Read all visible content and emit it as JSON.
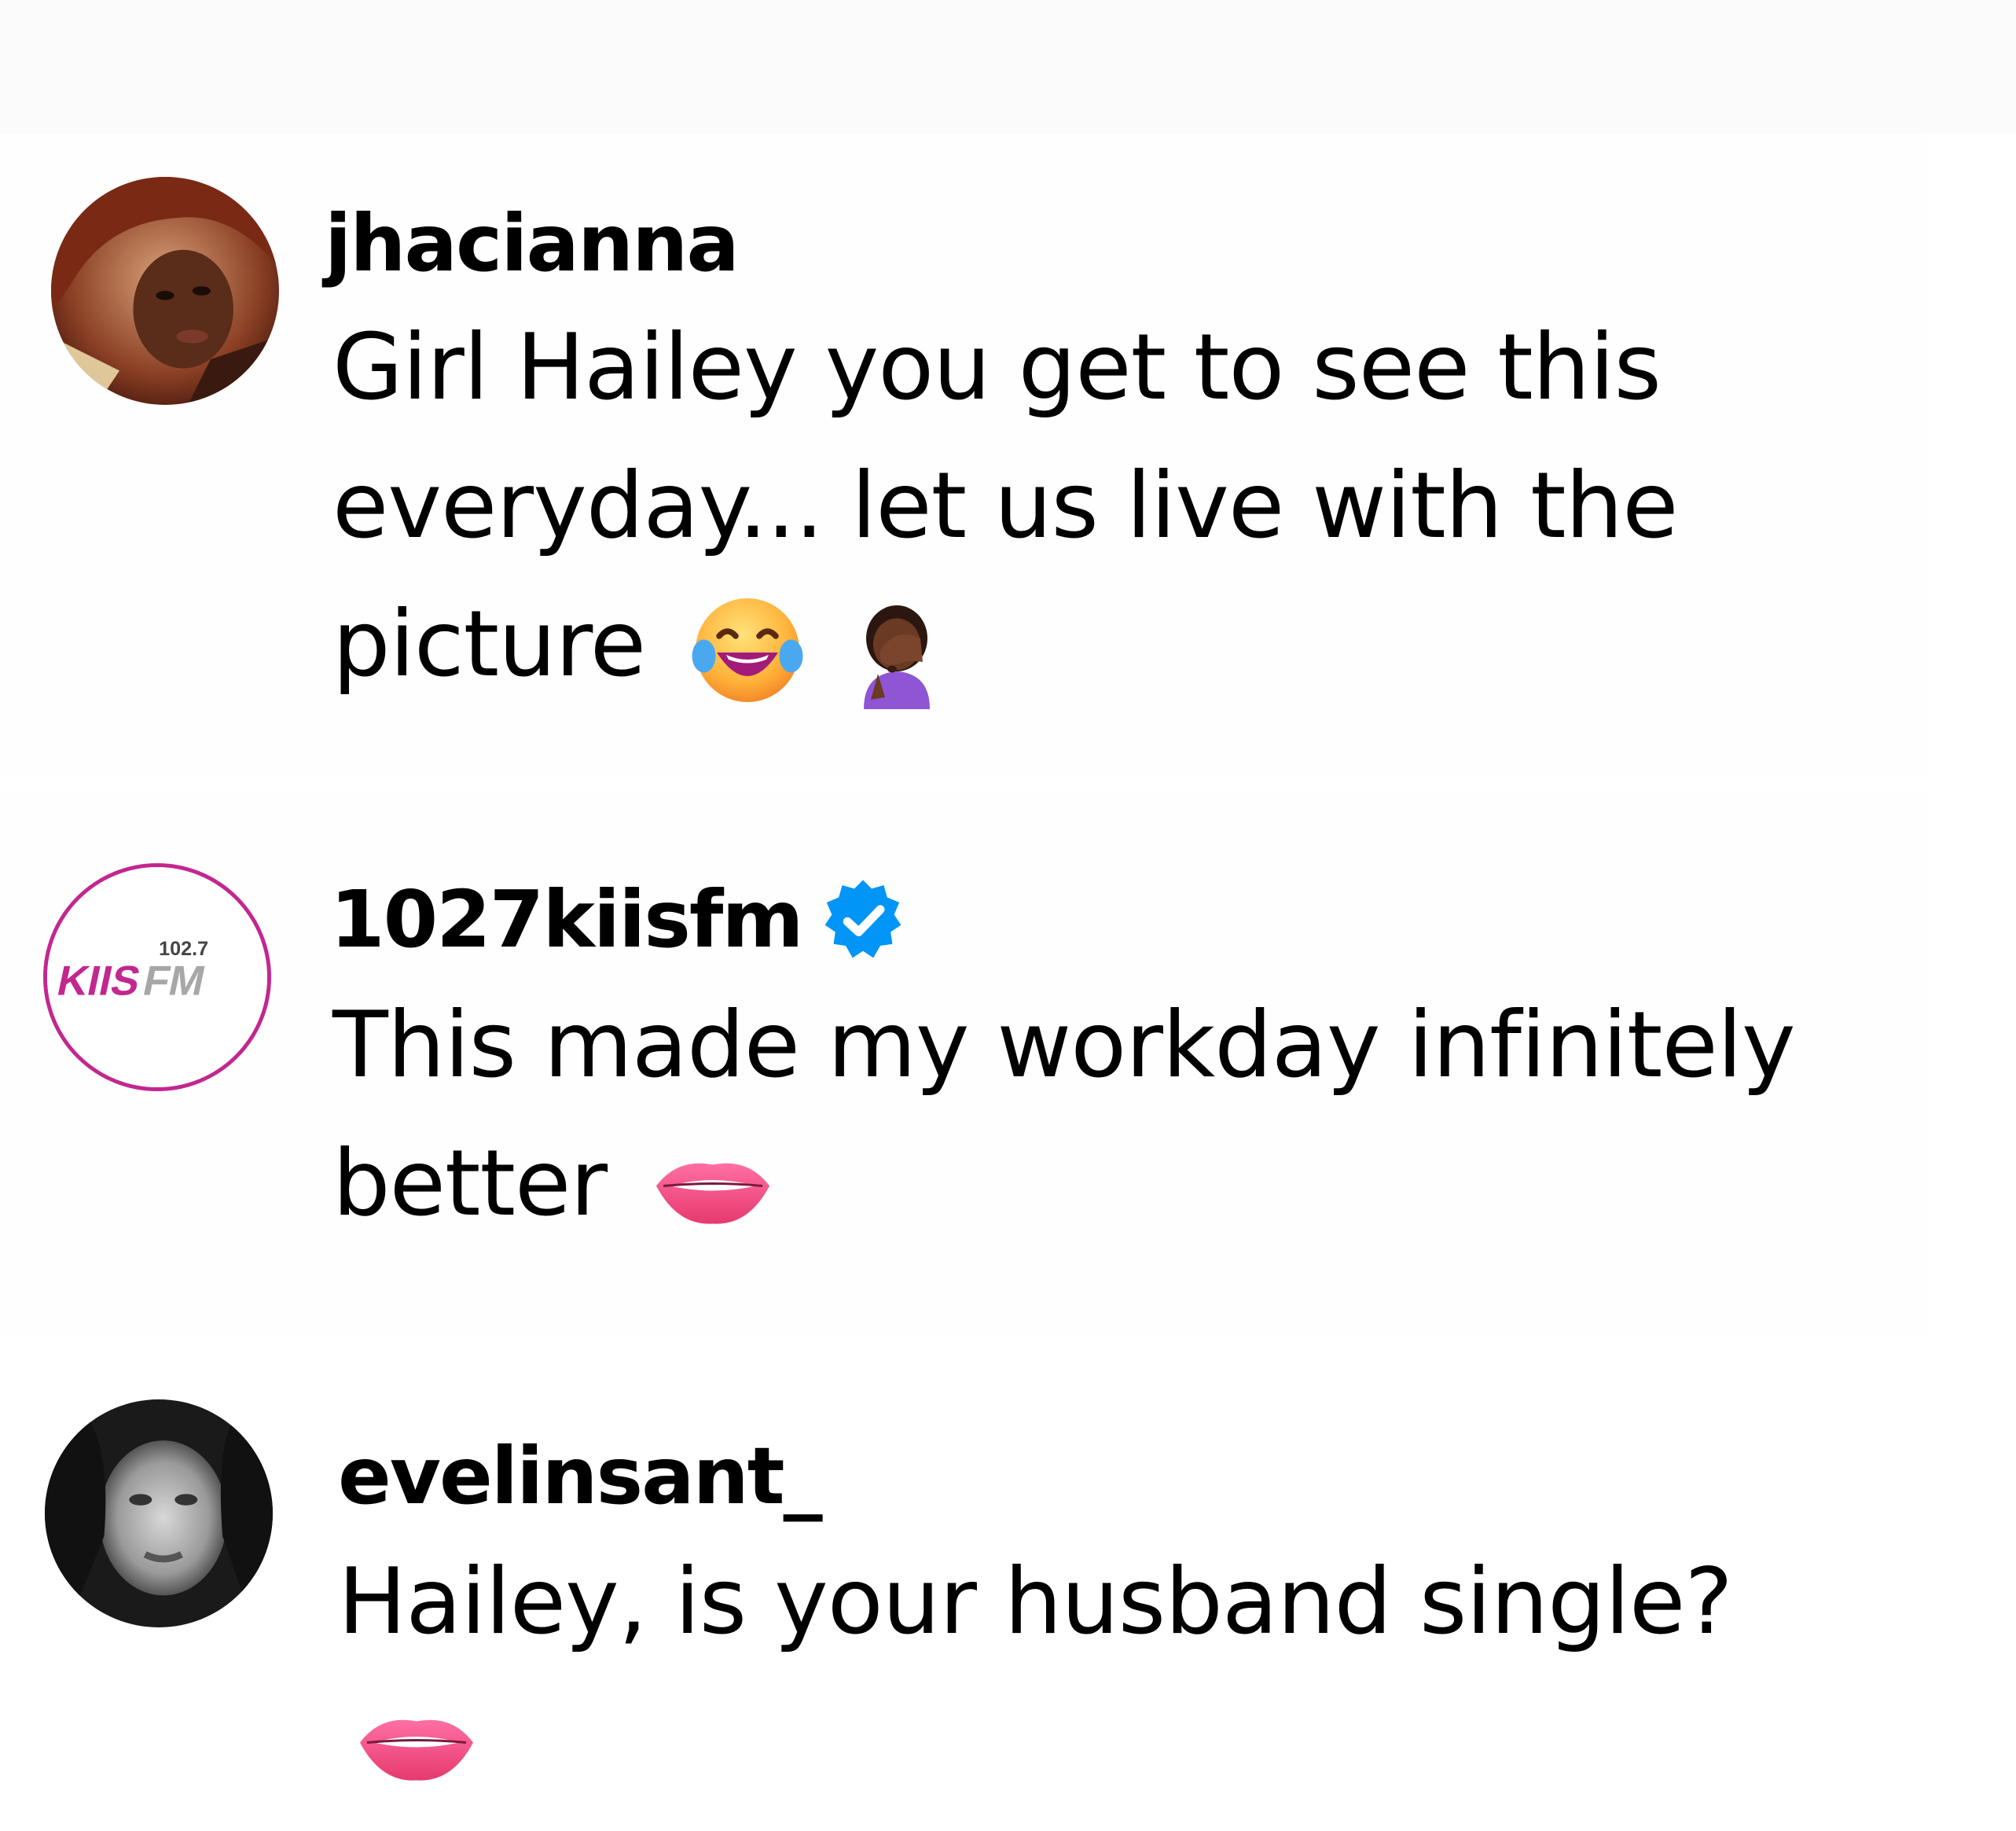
{
  "comments": [
    {
      "username": "jhacianna",
      "verified": false,
      "text_lines": [
        "Girl Hailey you get to see this",
        "everyday... let us live with the",
        "picture"
      ],
      "emojis": [
        "tears-of-joy-emoji",
        "facepalm-emoji"
      ],
      "avatar": "profile-photo"
    },
    {
      "username": "1027kiisfm",
      "verified": true,
      "text_lines": [
        "This made my workday infinitely",
        "better"
      ],
      "emojis": [
        "biting-lip-emoji"
      ],
      "avatar": {
        "logo_top": "102.7",
        "logo_main": "KIIS",
        "logo_suffix": "FM"
      }
    },
    {
      "username": "evelinsant_",
      "verified": false,
      "text_lines": [
        "Hailey, is your husband single?"
      ],
      "emojis": [
        "biting-lip-emoji"
      ],
      "avatar": "profile-photo-grayscale"
    }
  ],
  "colors": {
    "verified_badge": "#0095f6",
    "kiis_pink": "#c2278f",
    "kiis_gray": "#a7a7a7"
  }
}
